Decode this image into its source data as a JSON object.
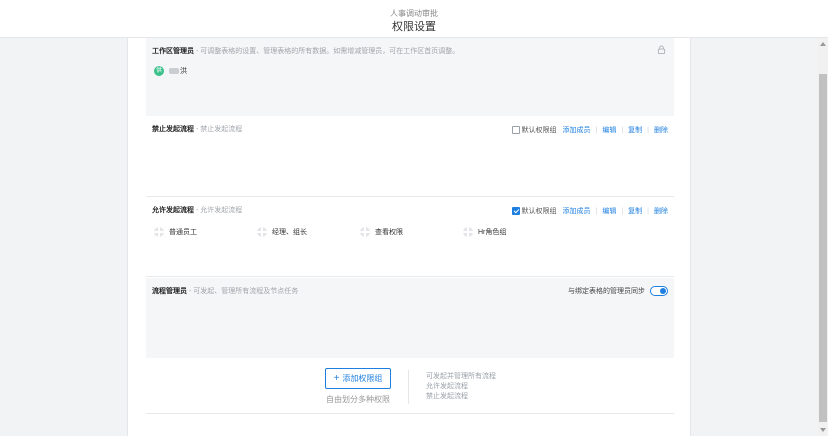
{
  "header": {
    "subtitle": "人事调动审批",
    "title": "权限设置"
  },
  "workspace_admin": {
    "title": "工作区管理员",
    "desc": "- 可调整表格的设置、管理表格的所有数据。如需增减管理员，可在工作区首页调整。",
    "member": {
      "avatar_text": "供",
      "name": "洪"
    }
  },
  "forbid_group": {
    "title": "禁止发起流程",
    "desc": "- 禁止发起流程",
    "default_label": "默认权限组",
    "default_checked": false,
    "actions": [
      "添加成员",
      "编辑",
      "复制",
      "删除"
    ]
  },
  "allow_group": {
    "title": "允许发起流程",
    "desc": "- 允许发起流程",
    "default_label": "默认权限组",
    "default_checked": true,
    "actions": [
      "添加成员",
      "编辑",
      "复制",
      "删除"
    ],
    "roles": [
      "普通员工",
      "经理、组长",
      "查看权限",
      "Hr角色组"
    ]
  },
  "flow_admin": {
    "title": "流程管理员",
    "desc": "- 可发起、管理所有流程及节点任务",
    "sync_label": "与绑定表格的管理员同步",
    "sync_on": true
  },
  "add_group": {
    "button_label": "添加权限组",
    "hint": "自由划分多种权限",
    "notes": [
      "可发起并管理所有流程",
      "允许发起流程",
      "禁止发起流程"
    ]
  },
  "colors": {
    "accent": "#1e7fe0",
    "avatar": "#3ac08a"
  }
}
